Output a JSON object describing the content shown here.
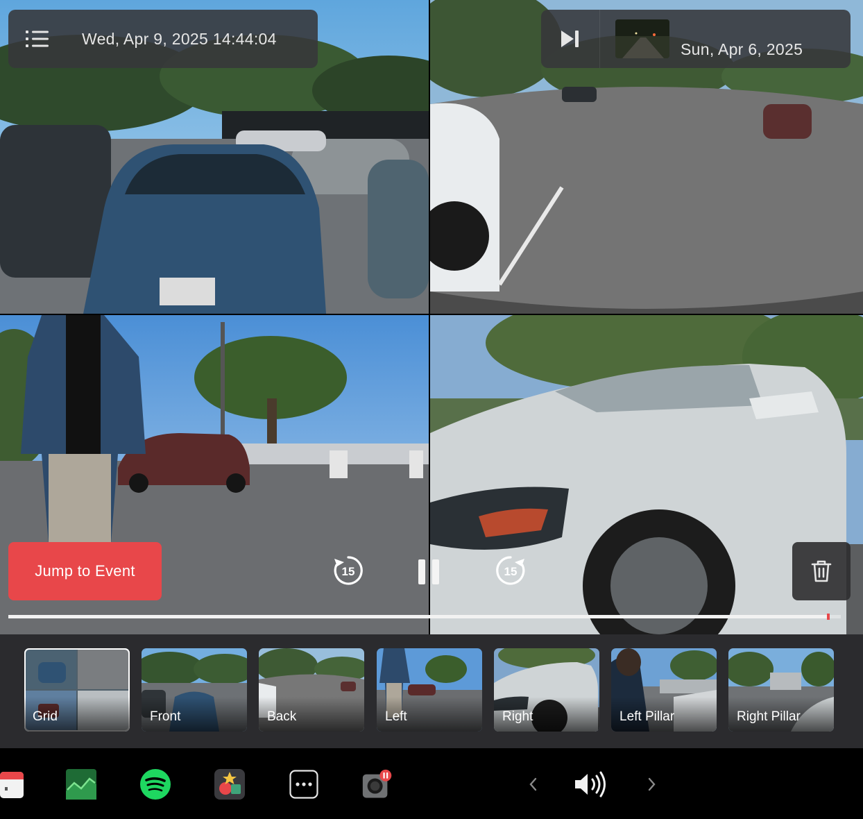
{
  "header_left": {
    "timestamp": "Wed, Apr 9, 2025 14:44:04",
    "menu_icon": "list-menu-icon"
  },
  "header_right": {
    "date": "Sun, Apr 6, 2025",
    "skip_icon": "skip-next-icon"
  },
  "controls": {
    "jump_label": "Jump to Event",
    "rewind_seconds": "15",
    "forward_seconds": "15",
    "progress": 0.985,
    "event_marker": 0.985
  },
  "views": [
    {
      "label": "Grid",
      "selected": true
    },
    {
      "label": "Front",
      "selected": false
    },
    {
      "label": "Back",
      "selected": false
    },
    {
      "label": "Left",
      "selected": false
    },
    {
      "label": "Right",
      "selected": false
    },
    {
      "label": "Left Pillar",
      "selected": false
    },
    {
      "label": "Right Pillar",
      "selected": false
    }
  ],
  "dock": {
    "apps": [
      "calendar-icon",
      "stocks-chart-icon",
      "spotify-icon",
      "toybox-icon",
      "more-apps-icon",
      "dashcam-icon"
    ],
    "dashcam_badge": "pause",
    "volume_icon": "volume-icon"
  },
  "colors": {
    "accent": "#e8474a",
    "panel": "#37373a",
    "strip": "#2b2b2e"
  }
}
